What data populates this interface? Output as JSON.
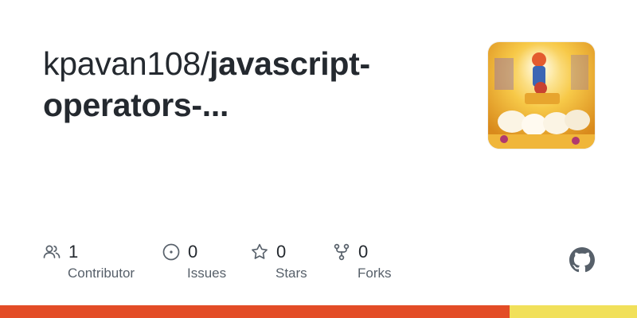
{
  "repo": {
    "owner": "kpavan108/",
    "name_line1": "javascript-",
    "name_line2": "operators-..."
  },
  "avatar": {
    "icon": "chariot-artwork"
  },
  "stats": [
    {
      "icon": "people-icon",
      "value": "1",
      "label": "Contributor"
    },
    {
      "icon": "issue-icon",
      "value": "0",
      "label": "Issues"
    },
    {
      "icon": "star-icon",
      "value": "0",
      "label": "Stars"
    },
    {
      "icon": "fork-icon",
      "value": "0",
      "label": "Forks"
    }
  ],
  "brand_icon": "github-icon",
  "languages": [
    {
      "color": "#e34c26",
      "fraction": 0.8
    },
    {
      "color": "#f1e05a",
      "fraction": 0.2
    }
  ]
}
